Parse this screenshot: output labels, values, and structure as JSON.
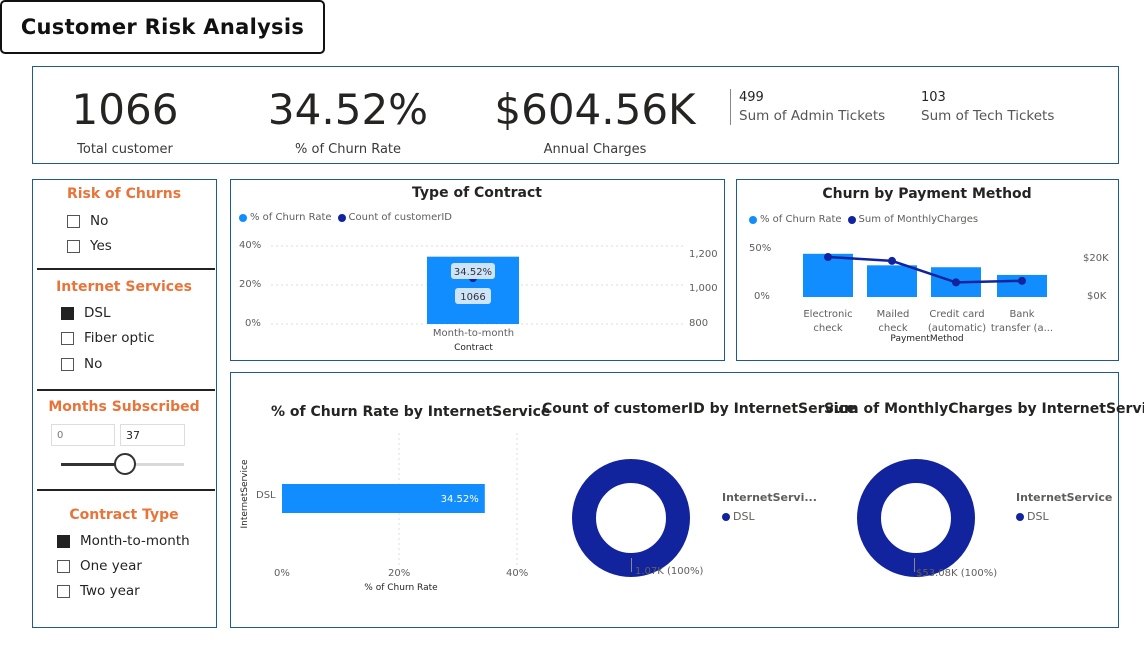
{
  "title": "Customer Risk Analysis",
  "kpis": {
    "total_customer": {
      "value": "1066",
      "label": "Total customer"
    },
    "churn_rate": {
      "value": "34.52%",
      "label": "% of Churn Rate"
    },
    "annual_charges": {
      "value": "$604.56K",
      "label": "Annual Charges"
    },
    "admin_tickets": {
      "value": "499",
      "label": "Sum of Admin Tickets"
    },
    "tech_tickets": {
      "value": "103",
      "label": "Sum of Tech Tickets"
    }
  },
  "slicers": {
    "risk": {
      "title": "Risk of Churns",
      "items": [
        {
          "label": "No",
          "checked": false
        },
        {
          "label": "Yes",
          "checked": false
        }
      ]
    },
    "internet": {
      "title": "Internet Services",
      "items": [
        {
          "label": "DSL",
          "checked": true
        },
        {
          "label": "Fiber optic",
          "checked": false
        },
        {
          "label": "No",
          "checked": false
        }
      ]
    },
    "months": {
      "title": "Months Subscribed",
      "min_placeholder": "0",
      "max_value": "37",
      "slider_fraction": 0.52
    },
    "contract": {
      "title": "Contract Type",
      "items": [
        {
          "label": "Month-to-month",
          "checked": true
        },
        {
          "label": "One year",
          "checked": false
        },
        {
          "label": "Two year",
          "checked": false
        }
      ]
    }
  },
  "colors": {
    "accent": "#118dff",
    "dark": "#12239e",
    "slicer_title": "#e8743b",
    "border": "#1f5c8e"
  },
  "contract_chart": {
    "title": "Type of Contract",
    "legend": [
      "% of Churn Rate",
      "Count of customerID"
    ],
    "xlabel": "Contract",
    "left_ticks": [
      "40%",
      "20%",
      "0%"
    ],
    "right_ticks": [
      "1,200",
      "1,000",
      "800"
    ],
    "data_labels": [
      "34.52%",
      "1066"
    ]
  },
  "payment_chart": {
    "title": "Churn by Payment Method",
    "legend": [
      "% of Churn Rate",
      "Sum of MonthlyCharges"
    ],
    "xlabel": "PaymentMethod",
    "left_ticks": [
      "50%",
      "0%"
    ],
    "right_ticks": [
      "$20K",
      "$0K"
    ],
    "categories": [
      [
        "Electronic",
        "check"
      ],
      [
        "Mailed",
        "check"
      ],
      [
        "Credit card",
        "(automatic)"
      ],
      [
        "Bank",
        "transfer (a..."
      ]
    ]
  },
  "internet_bar_chart": {
    "title": "% of Churn Rate by InternetService",
    "ylabel": "InternetService",
    "xlabel": "% of Churn Rate",
    "x_ticks": [
      "0%",
      "20%",
      "40%"
    ],
    "data_label": "34.52%"
  },
  "donut_count": {
    "title": "Count of customerID by InternetService",
    "legend_title": "InternetServi...",
    "legend_item": "DSL",
    "data_label": "1.07K (100%)"
  },
  "donut_charges": {
    "title": "Sum of MonthlyCharges by InternetService",
    "legend_title": "InternetService",
    "legend_item": "DSL",
    "data_label": "$53.08K (100%)"
  },
  "chart_data": [
    {
      "type": "bar",
      "title": "Type of Contract",
      "xlabel": "Contract",
      "categories": [
        "Month-to-month"
      ],
      "series": [
        {
          "name": "% of Churn Rate",
          "values": [
            34.52
          ]
        },
        {
          "name": "Count of customerID",
          "values": [
            1066
          ]
        }
      ],
      "ylim_left": [
        0,
        40
      ],
      "ylim_right": [
        800,
        1200
      ]
    },
    {
      "type": "bar",
      "title": "Churn by Payment Method",
      "xlabel": "PaymentMethod",
      "categories": [
        "Electronic check",
        "Mailed check",
        "Credit card (automatic)",
        "Bank transfer (a..."
      ],
      "series": [
        {
          "name": "% of Churn Rate",
          "values": [
            45,
            33,
            31,
            23
          ]
        },
        {
          "name": "Sum of MonthlyCharges",
          "values": [
            20500,
            18500,
            7500,
            8300
          ]
        }
      ],
      "ylim_left": [
        0,
        50
      ],
      "ylim_right": [
        0,
        20000
      ]
    },
    {
      "type": "bar",
      "title": "% of Churn Rate by InternetService",
      "xlabel": "% of Churn Rate",
      "ylabel": "InternetService",
      "categories": [
        "DSL"
      ],
      "values": [
        34.52
      ],
      "xlim": [
        0,
        40
      ]
    },
    {
      "type": "pie",
      "title": "Count of customerID by InternetService",
      "categories": [
        "DSL"
      ],
      "values": [
        1066
      ]
    },
    {
      "type": "pie",
      "title": "Sum of MonthlyCharges by InternetService",
      "categories": [
        "DSL"
      ],
      "values": [
        53080
      ]
    }
  ]
}
